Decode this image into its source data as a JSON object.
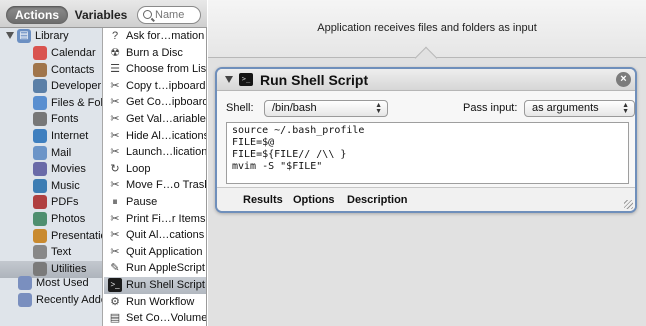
{
  "topbar": {
    "actions_label": "Actions",
    "variables_label": "Variables",
    "search_placeholder": "Name"
  },
  "library": {
    "root_label": "Library",
    "items": [
      {
        "label": "Calendar",
        "icon": "calendar-icon",
        "color": "#d9534f"
      },
      {
        "label": "Contacts",
        "icon": "contacts-icon",
        "color": "#a0754b"
      },
      {
        "label": "Developer",
        "icon": "developer-icon",
        "color": "#5b7fa7"
      },
      {
        "label": "Files & Folders",
        "icon": "finder-icon",
        "color": "#5a8fd0"
      },
      {
        "label": "Fonts",
        "icon": "fonts-icon",
        "color": "#777777"
      },
      {
        "label": "Internet",
        "icon": "globe-icon",
        "color": "#3f7fbf"
      },
      {
        "label": "Mail",
        "icon": "mail-icon",
        "color": "#6c95c8"
      },
      {
        "label": "Movies",
        "icon": "movies-icon",
        "color": "#6a6aa8"
      },
      {
        "label": "Music",
        "icon": "music-icon",
        "color": "#3d7db3"
      },
      {
        "label": "PDFs",
        "icon": "pdf-icon",
        "color": "#b04040"
      },
      {
        "label": "Photos",
        "icon": "photos-icon",
        "color": "#4f8f6f"
      },
      {
        "label": "Presentations",
        "icon": "presentation-icon",
        "color": "#c98a2f"
      },
      {
        "label": "Text",
        "icon": "text-icon",
        "color": "#888888"
      },
      {
        "label": "Utilities",
        "icon": "utilities-icon",
        "color": "#7a7a7a"
      }
    ],
    "selected_item": "Utilities",
    "smart_groups": [
      {
        "label": "Most Used",
        "icon": "folder-icon",
        "color": "#7a8fbf"
      },
      {
        "label": "Recently Added",
        "icon": "folder-icon",
        "color": "#7a8fbf"
      }
    ]
  },
  "actions": {
    "items": [
      {
        "label": "Ask for…mation",
        "icon": "ask-icon",
        "glyph": "?"
      },
      {
        "label": "Burn a Disc",
        "icon": "burn-disc-icon",
        "glyph": "☢"
      },
      {
        "label": "Choose from List",
        "icon": "choose-list-icon",
        "glyph": "☰"
      },
      {
        "label": "Copy t…ipboard",
        "icon": "copy-clipboard-icon",
        "glyph": "✂"
      },
      {
        "label": "Get Co…ipboard",
        "icon": "get-clipboard-icon",
        "glyph": "✂"
      },
      {
        "label": "Get Val…ariable",
        "icon": "variable-icon",
        "glyph": "✂"
      },
      {
        "label": "Hide Al…ications",
        "icon": "hide-apps-icon",
        "glyph": "✂"
      },
      {
        "label": "Launch…lication",
        "icon": "launch-app-icon",
        "glyph": "✂"
      },
      {
        "label": "Loop",
        "icon": "loop-icon",
        "glyph": "↻"
      },
      {
        "label": "Move F…o Trash",
        "icon": "trash-icon",
        "glyph": "✂"
      },
      {
        "label": "Pause",
        "icon": "pause-icon",
        "glyph": "⏸"
      },
      {
        "label": "Print Fi…r Items",
        "icon": "print-icon",
        "glyph": "✂"
      },
      {
        "label": "Quit Al…cations",
        "icon": "quit-all-icon",
        "glyph": "✂"
      },
      {
        "label": "Quit Application",
        "icon": "quit-app-icon",
        "glyph": "✂"
      },
      {
        "label": "Run AppleScript",
        "icon": "applescript-icon",
        "glyph": "✎"
      },
      {
        "label": "Run Shell Script",
        "icon": "terminal-icon",
        "glyph": ">_"
      },
      {
        "label": "Run Workflow",
        "icon": "workflow-icon",
        "glyph": "⚙"
      },
      {
        "label": "Set Co…Volume",
        "icon": "volume-icon",
        "glyph": "▤"
      }
    ],
    "selected_item": "Run Shell Script"
  },
  "workflow": {
    "receives_text": "Application receives files and folders as input",
    "action_card": {
      "title": "Run Shell Script",
      "shell_label": "Shell:",
      "shell_value": "/bin/bash",
      "pass_input_label": "Pass input:",
      "pass_input_value": "as arguments",
      "script": "source ~/.bash_profile\nFILE=$@\nFILE=${FILE// /\\\\ }\nmvim -S \"$FILE\"",
      "footer_tabs": [
        "Results",
        "Options",
        "Description"
      ]
    }
  },
  "colors": {
    "card_border": "#6f8fbb",
    "sidebar_bg": "#dfe4ea",
    "selection_bg": "#b2b8c0"
  }
}
